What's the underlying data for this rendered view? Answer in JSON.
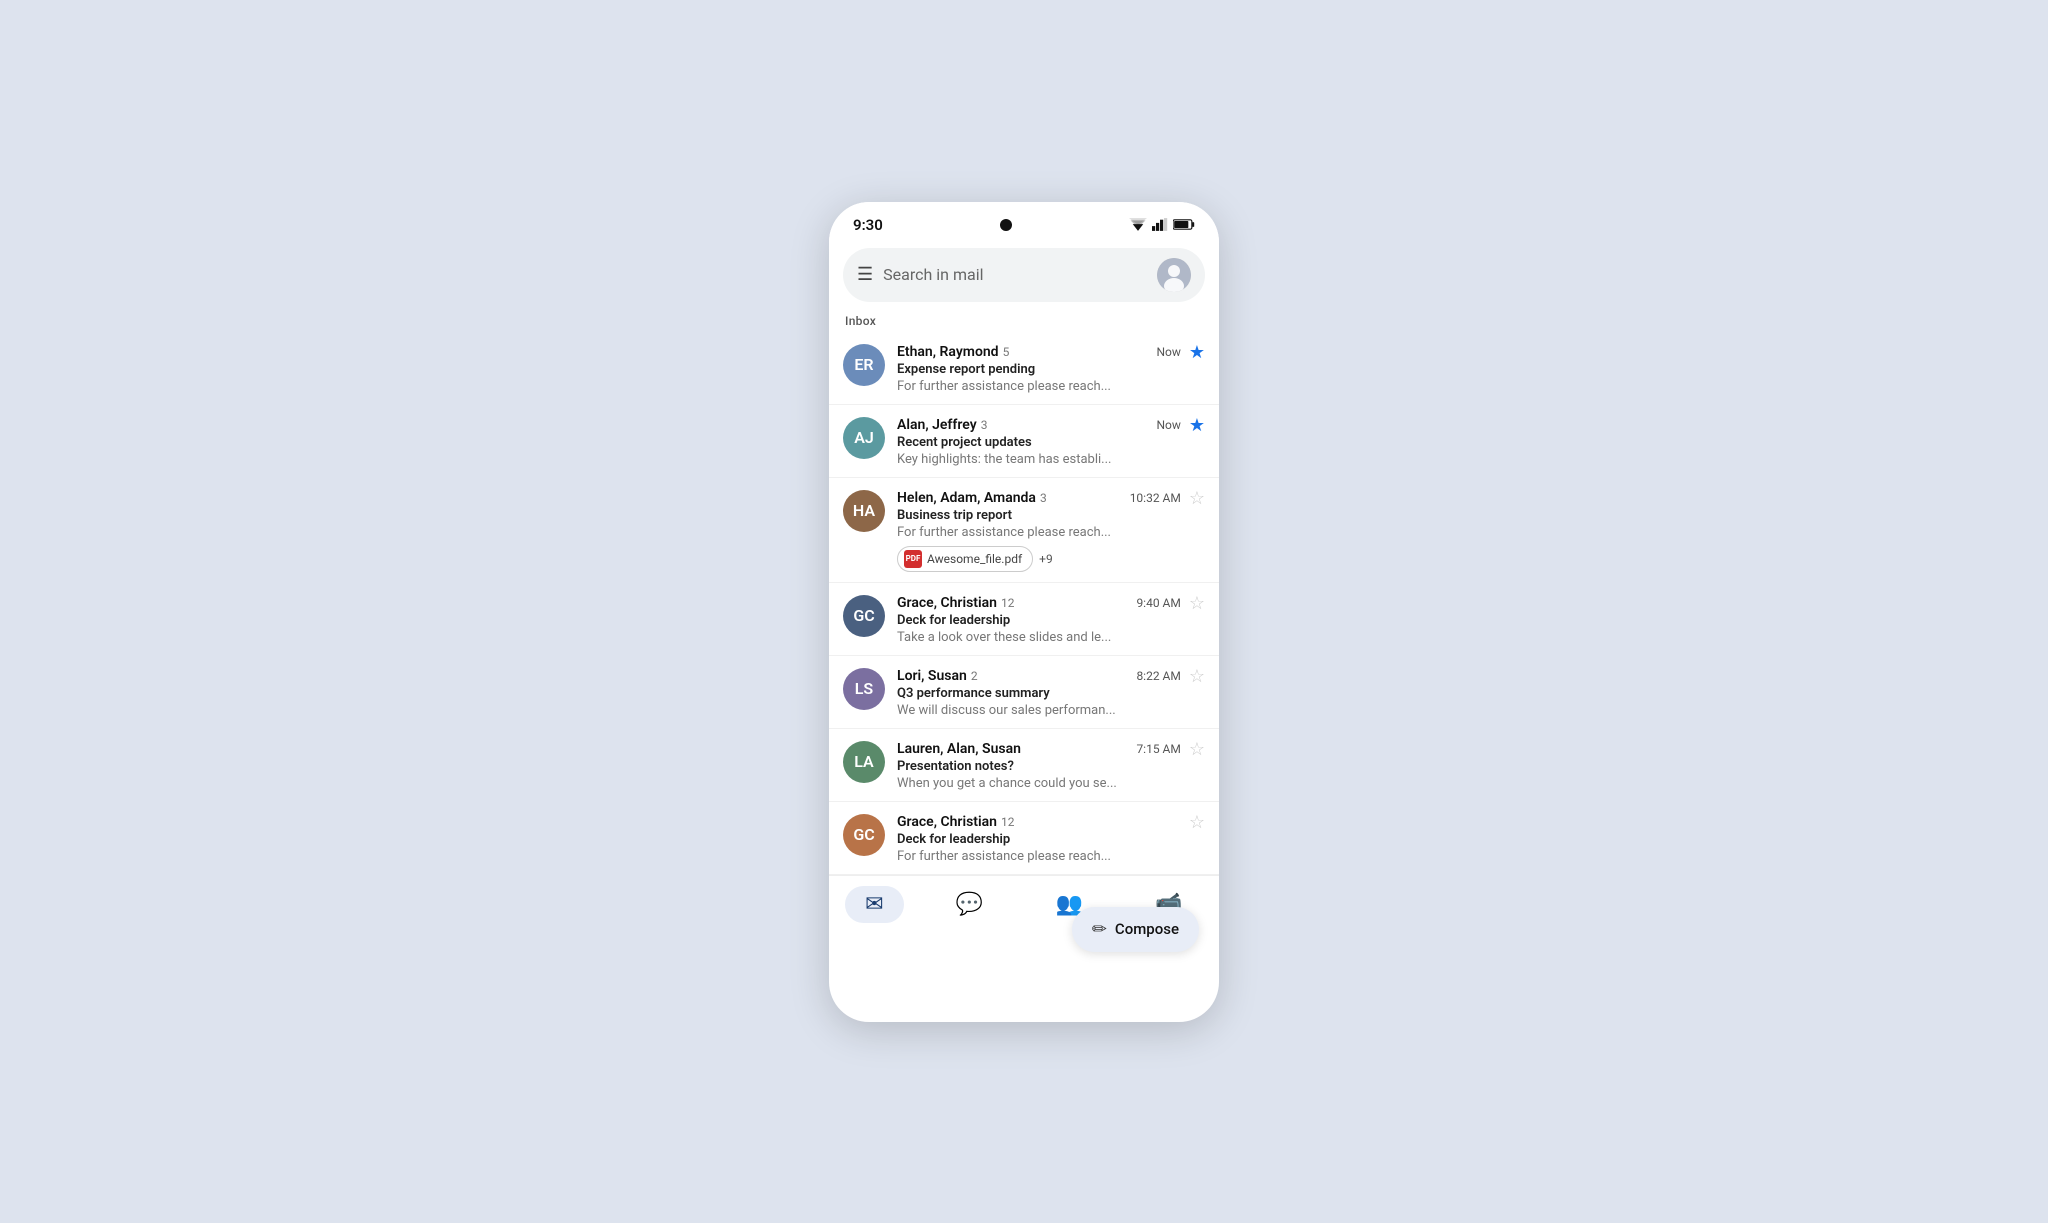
{
  "phone": {
    "time": "9:30"
  },
  "search": {
    "placeholder": "Search in mail"
  },
  "inbox": {
    "section_label": "Inbox",
    "emails": [
      {
        "id": 1,
        "sender": "Ethan, Raymond",
        "count": 5,
        "time": "Now",
        "subject": "Expense report pending",
        "preview": "For further assistance please reach...",
        "starred": true,
        "avatar_initials": "ER",
        "avatar_color": "av-blue",
        "attachments": []
      },
      {
        "id": 2,
        "sender": "Alan, Jeffrey",
        "count": 3,
        "time": "Now",
        "subject": "Recent project updates",
        "preview": "Key highlights: the team has establi...",
        "starred": true,
        "avatar_initials": "AJ",
        "avatar_color": "av-teal",
        "attachments": []
      },
      {
        "id": 3,
        "sender": "Helen, Adam, Amanda",
        "count": 3,
        "time": "10:32 AM",
        "subject": "Business trip report",
        "preview": "For further assistance please reach...",
        "starred": false,
        "avatar_initials": "HA",
        "avatar_color": "av-brown",
        "attachments": [
          {
            "name": "Awesome_file.pdf",
            "extra": "+9"
          }
        ]
      },
      {
        "id": 4,
        "sender": "Grace, Christian",
        "count": 12,
        "time": "9:40 AM",
        "subject": "Deck for leadership",
        "preview": "Take a look over these slides and le...",
        "starred": false,
        "avatar_initials": "GC",
        "avatar_color": "av-dark",
        "attachments": []
      },
      {
        "id": 5,
        "sender": "Lori, Susan",
        "count": 2,
        "time": "8:22 AM",
        "subject": "Q3 performance summary",
        "preview": "We will discuss our sales performan...",
        "starred": false,
        "avatar_initials": "LS",
        "avatar_color": "av-purple",
        "attachments": []
      },
      {
        "id": 6,
        "sender": "Lauren, Alan, Susan",
        "count": 0,
        "time": "7:15 AM",
        "subject": "Presentation notes?",
        "preview": "When you get a chance could you se...",
        "starred": false,
        "avatar_initials": "LA",
        "avatar_color": "av-green",
        "attachments": []
      },
      {
        "id": 7,
        "sender": "Grace, Christian",
        "count": 12,
        "time": "",
        "subject": "Deck for leadership",
        "preview": "For further assistance please reach...",
        "starred": false,
        "avatar_initials": "GC",
        "avatar_color": "av-orange",
        "attachments": []
      }
    ]
  },
  "compose": {
    "label": "Compose"
  },
  "bottom_nav": {
    "items": [
      {
        "id": "mail",
        "label": "Mail",
        "active": true,
        "icon": "✉"
      },
      {
        "id": "chat",
        "label": "Chat",
        "active": false,
        "icon": "💬"
      },
      {
        "id": "spaces",
        "label": "Spaces",
        "active": false,
        "icon": "👥"
      },
      {
        "id": "meet",
        "label": "Meet",
        "active": false,
        "icon": "📹"
      }
    ]
  },
  "icons": {
    "menu": "☰",
    "star_filled": "★",
    "star_empty": "☆",
    "pencil": "✏",
    "pdf_label": "PDF"
  }
}
